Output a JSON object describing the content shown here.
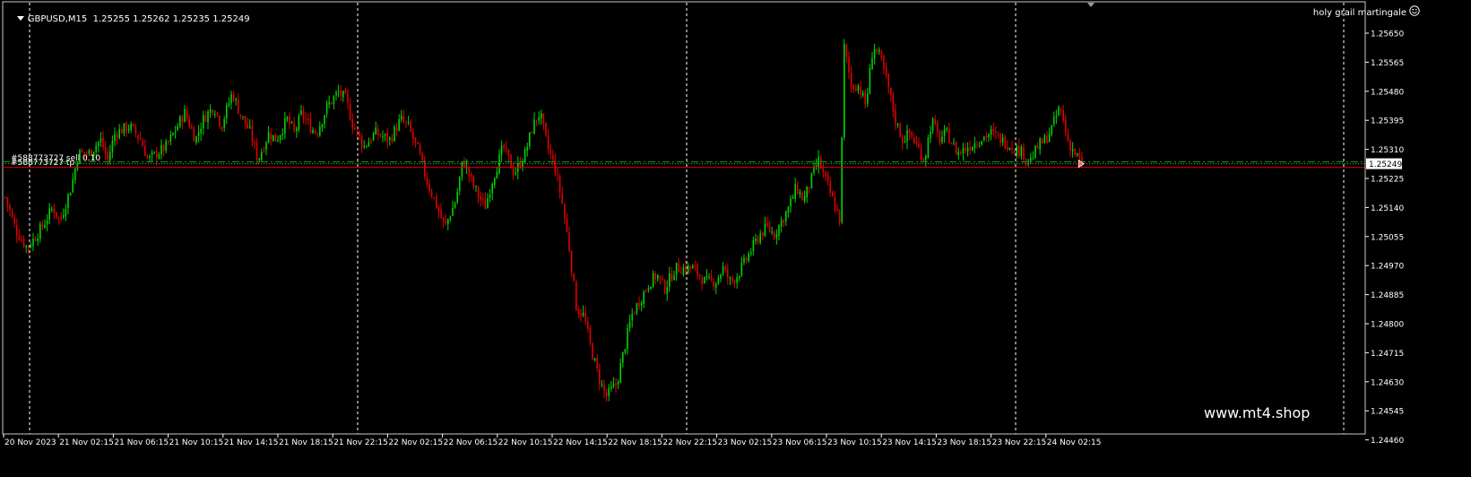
{
  "header": {
    "symbol": "GBPUSD,M15",
    "ohlc": "1.25255 1.25262 1.25235 1.25249"
  },
  "expert": {
    "name": "holy grail martingale",
    "icon": "smiley-icon"
  },
  "watermark": "www.mt4.shop",
  "orders": {
    "sell_label": "#588773727 sell 0.10",
    "tp_label": "#588773727 tp"
  },
  "colors": {
    "background": "#000000",
    "bull": "#00d400",
    "bear": "#e00000",
    "grid": "#ffffff",
    "order_line": "#00b000",
    "tp_line": "#e00000",
    "price_tag_bg": "#ffffff",
    "text": "#ffffff"
  },
  "price_axis": {
    "labels": [
      "1.25650",
      "1.25565",
      "1.25480",
      "1.25395",
      "1.25310",
      "1.25225",
      "1.25140",
      "1.25055",
      "1.24970",
      "1.24885",
      "1.24800",
      "1.24715",
      "1.24630",
      "1.24545",
      "1.24460"
    ],
    "current_price": "1.25249"
  },
  "time_axis": {
    "labels": [
      "20 Nov 2023",
      "21 Nov 02:15",
      "21 Nov 06:15",
      "21 Nov 10:15",
      "21 Nov 14:15",
      "21 Nov 18:15",
      "21 Nov 22:15",
      "22 Nov 02:15",
      "22 Nov 06:15",
      "22 Nov 10:15",
      "22 Nov 14:15",
      "22 Nov 18:15",
      "22 Nov 22:15",
      "23 Nov 02:15",
      "23 Nov 06:15",
      "23 Nov 10:15",
      "23 Nov 14:15",
      "23 Nov 18:15",
      "23 Nov 22:15",
      "24 Nov 02:15"
    ]
  },
  "chart_data": {
    "type": "candlestick",
    "symbol": "GBPUSD",
    "timeframe": "M15",
    "ylim": [
      1.2445,
      1.2568
    ],
    "x_start": "20 Nov 2023",
    "x_end": "24 Nov 02:15",
    "grid": "vertical-dashed",
    "last_price": 1.25249,
    "order_price": 1.25255,
    "tp_price": 1.25238,
    "path": [
      [
        0,
        1.2515
      ],
      [
        6,
        1.2505
      ],
      [
        12,
        1.25
      ],
      [
        20,
        1.2506
      ],
      [
        26,
        1.2512
      ],
      [
        30,
        1.2508
      ],
      [
        36,
        1.2518
      ],
      [
        40,
        1.2528
      ],
      [
        46,
        1.2528
      ],
      [
        52,
        1.2532
      ],
      [
        56,
        1.2526
      ],
      [
        60,
        1.2534
      ],
      [
        68,
        1.2536
      ],
      [
        74,
        1.2532
      ],
      [
        78,
        1.2526
      ],
      [
        83,
        1.2528
      ],
      [
        88,
        1.253
      ],
      [
        94,
        1.2536
      ],
      [
        98,
        1.254
      ],
      [
        104,
        1.2532
      ],
      [
        108,
        1.2538
      ],
      [
        114,
        1.2542
      ],
      [
        118,
        1.2536
      ],
      [
        124,
        1.2546
      ],
      [
        128,
        1.254
      ],
      [
        134,
        1.2534
      ],
      [
        138,
        1.2526
      ],
      [
        144,
        1.2534
      ],
      [
        148,
        1.2532
      ],
      [
        154,
        1.2538
      ],
      [
        158,
        1.2534
      ],
      [
        162,
        1.254
      ],
      [
        166,
        1.2536
      ],
      [
        170,
        1.2534
      ],
      [
        176,
        1.2542
      ],
      [
        182,
        1.2546
      ],
      [
        186,
        1.2544
      ],
      [
        190,
        1.2536
      ],
      [
        196,
        1.253
      ],
      [
        202,
        1.2534
      ],
      [
        210,
        1.2532
      ],
      [
        216,
        1.2538
      ],
      [
        220,
        1.2536
      ],
      [
        226,
        1.2528
      ],
      [
        230,
        1.252
      ],
      [
        236,
        1.2512
      ],
      [
        240,
        1.2506
      ],
      [
        246,
        1.2514
      ],
      [
        250,
        1.2526
      ],
      [
        256,
        1.2518
      ],
      [
        262,
        1.2512
      ],
      [
        266,
        1.252
      ],
      [
        272,
        1.253
      ],
      [
        278,
        1.2522
      ],
      [
        284,
        1.2528
      ],
      [
        288,
        1.2536
      ],
      [
        292,
        1.254
      ],
      [
        296,
        1.253
      ],
      [
        300,
        1.2524
      ],
      [
        304,
        1.2514
      ],
      [
        308,
        1.25
      ],
      [
        312,
        1.2482
      ],
      [
        316,
        1.248
      ],
      [
        320,
        1.247
      ],
      [
        324,
        1.2462
      ],
      [
        328,
        1.2456
      ],
      [
        334,
        1.246
      ],
      [
        338,
        1.247
      ],
      [
        342,
        1.248
      ],
      [
        348,
        1.2486
      ],
      [
        352,
        1.249
      ],
      [
        356,
        1.2492
      ],
      [
        360,
        1.2488
      ],
      [
        366,
        1.2494
      ],
      [
        370,
        1.2494
      ],
      [
        376,
        1.2494
      ],
      [
        382,
        1.249
      ],
      [
        388,
        1.249
      ],
      [
        392,
        1.2494
      ],
      [
        396,
        1.249
      ],
      [
        400,
        1.2492
      ],
      [
        404,
        1.2496
      ],
      [
        408,
        1.25
      ],
      [
        412,
        1.2504
      ],
      [
        416,
        1.2506
      ],
      [
        420,
        1.2504
      ],
      [
        424,
        1.2508
      ],
      [
        428,
        1.2512
      ],
      [
        432,
        1.2518
      ],
      [
        436,
        1.2514
      ],
      [
        440,
        1.252
      ],
      [
        444,
        1.2526
      ],
      [
        448,
        1.252
      ],
      [
        452,
        1.2514
      ],
      [
        456,
        1.2508
      ],
      [
        458,
        1.256
      ],
      [
        462,
        1.2548
      ],
      [
        466,
        1.2548
      ],
      [
        470,
        1.2542
      ],
      [
        474,
        1.256
      ],
      [
        478,
        1.2556
      ],
      [
        482,
        1.2548
      ],
      [
        486,
        1.2538
      ],
      [
        490,
        1.2532
      ],
      [
        494,
        1.2534
      ],
      [
        498,
        1.253
      ],
      [
        502,
        1.2526
      ],
      [
        506,
        1.2538
      ],
      [
        510,
        1.2532
      ],
      [
        514,
        1.2534
      ],
      [
        520,
        1.2528
      ],
      [
        526,
        1.253
      ],
      [
        532,
        1.2532
      ],
      [
        538,
        1.2534
      ],
      [
        544,
        1.2532
      ],
      [
        550,
        1.253
      ],
      [
        556,
        1.2528
      ],
      [
        560,
        1.2526
      ],
      [
        564,
        1.253
      ],
      [
        568,
        1.2532
      ],
      [
        572,
        1.2536
      ],
      [
        576,
        1.2542
      ],
      [
        580,
        1.2532
      ],
      [
        584,
        1.2528
      ],
      [
        588,
        1.2525
      ]
    ]
  }
}
